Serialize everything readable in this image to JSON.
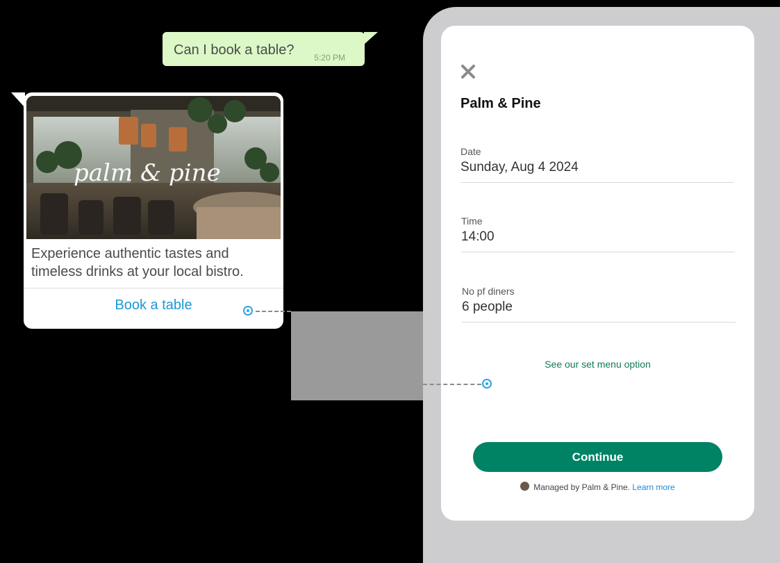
{
  "chat": {
    "outgoing_message": "Can I book a table?",
    "outgoing_time": "5:20 PM"
  },
  "card": {
    "image_logo_text": "palm & pine",
    "description": "Experience authentic tastes and timeless drinks at your local bistro.",
    "action_label": "Book a table"
  },
  "sheet": {
    "close_icon": "close-icon",
    "title": "Palm & Pine",
    "fields": [
      {
        "label": "Date",
        "value": "Sunday, Aug 4 2024"
      },
      {
        "label": "Time",
        "value": "14:00"
      },
      {
        "label": "No pf diners",
        "value": "6 people"
      }
    ],
    "set_menu_link": "See our set menu option",
    "continue_label": "Continue",
    "footer_text": "Managed by Palm & Pine.",
    "footer_link": "Learn more"
  },
  "colors": {
    "outgoing_bubble": "#dcf8c6",
    "link_blue": "#1a9ad6",
    "primary_green": "#008265"
  }
}
